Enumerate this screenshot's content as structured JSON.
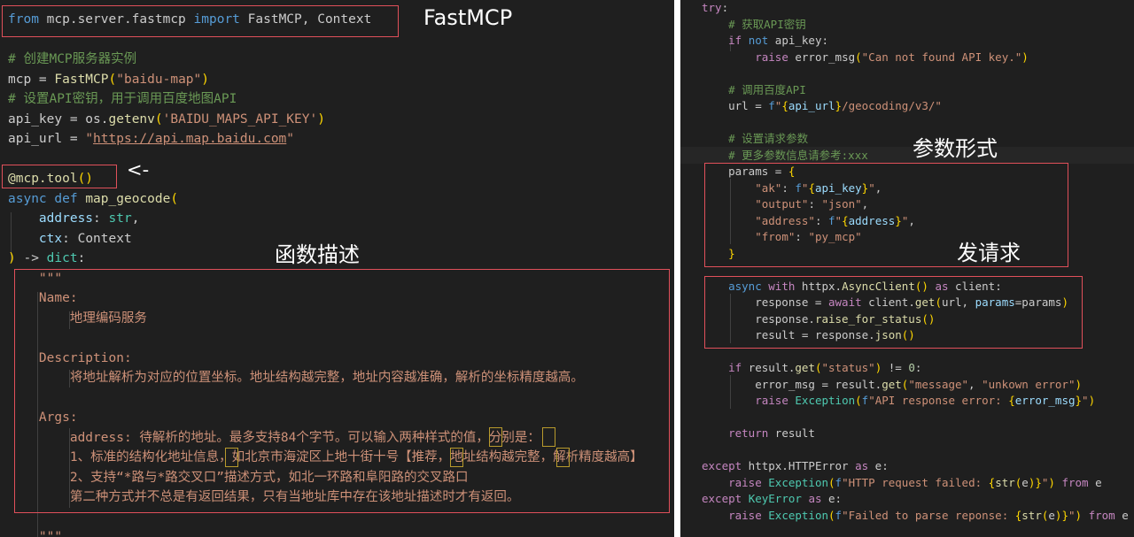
{
  "left_code": [
    [
      [
        "kw",
        "from"
      ],
      [
        "p",
        " mcp.server.fastmcp "
      ],
      [
        "kw",
        "import"
      ],
      [
        "p",
        " FastMCP, Context"
      ]
    ],
    [],
    [
      [
        "cm",
        "# 创建MCP服务器实例"
      ]
    ],
    [
      [
        "p",
        "mcp = "
      ],
      [
        "fn",
        "FastMCP"
      ],
      [
        "br",
        "("
      ],
      [
        "str",
        "\"baidu-map\""
      ],
      [
        "br",
        ")"
      ]
    ],
    [
      [
        "cm",
        "# 设置API密钥，用于调用百度地图API"
      ]
    ],
    [
      [
        "p",
        "api_key = os."
      ],
      [
        "fn",
        "getenv"
      ],
      [
        "br",
        "("
      ],
      [
        "str",
        "'BAIDU_MAPS_API_KEY'"
      ],
      [
        "br",
        ")"
      ]
    ],
    [
      [
        "p",
        "api_url = "
      ],
      [
        "str",
        "\""
      ],
      [
        "url",
        "https://api.map.baidu.com"
      ],
      [
        "str",
        "\""
      ]
    ],
    [],
    [
      [
        "fn",
        "@mcp.tool"
      ],
      [
        "br",
        "()"
      ]
    ],
    [
      [
        "kw",
        "async"
      ],
      [
        "p",
        " "
      ],
      [
        "kw",
        "def"
      ],
      [
        "p",
        " "
      ],
      [
        "fn",
        "map_geocode"
      ],
      [
        "br",
        "("
      ]
    ],
    [
      [
        "p",
        "    "
      ],
      [
        "var",
        "address"
      ],
      [
        "p",
        ": "
      ],
      [
        "cls",
        "str"
      ],
      [
        "p",
        ","
      ]
    ],
    [
      [
        "p",
        "    "
      ],
      [
        "var",
        "ctx"
      ],
      [
        "p",
        ": Context"
      ]
    ],
    [
      [
        "br",
        ")"
      ],
      [
        "p",
        " -> "
      ],
      [
        "cls",
        "dict"
      ],
      [
        "p",
        ":"
      ]
    ],
    [
      [
        "doc",
        "    \"\"\""
      ]
    ],
    [
      [
        "doc",
        "    Name:"
      ]
    ],
    [
      [
        "doc",
        "        地理编码服务"
      ]
    ],
    [],
    [
      [
        "doc",
        "    Description:"
      ]
    ],
    [
      [
        "doc",
        "        将地址解析为对应的位置坐标。地址结构越完整，地址内容越准确，解析的坐标精度越高。"
      ]
    ],
    [],
    [
      [
        "doc",
        "    Args:"
      ]
    ],
    [
      [
        "doc",
        "        address: 待解析的地址。最多支持84个字节。可以输入两种样式的值，分别是："
      ]
    ],
    [
      [
        "doc",
        "        1、标准的结构化地址信息，如北京市海淀区上地十街十号【推荐，地址结构越完整，解析精度越高】"
      ]
    ],
    [
      [
        "doc",
        "        2、支持“*路与*路交叉口”描述方式，如北一环路和阜阳路的交叉路口"
      ]
    ],
    [
      [
        "doc",
        "        第二种方式并不总是有返回结果，只有当地址库中存在该地址描述时才有返回。"
      ]
    ],
    [],
    [
      [
        "doc",
        "    \"\"\""
      ]
    ]
  ],
  "right_code": [
    [
      [
        "ctl",
        "try"
      ],
      [
        "p",
        ":"
      ]
    ],
    [
      [
        "cm",
        "    # 获取API密钥"
      ]
    ],
    [
      [
        "p",
        "    "
      ],
      [
        "ctl",
        "if"
      ],
      [
        "p",
        " "
      ],
      [
        "kw",
        "not"
      ],
      [
        "p",
        " api_key:"
      ]
    ],
    [
      [
        "p",
        "        "
      ],
      [
        "ctl",
        "raise"
      ],
      [
        "p",
        " error_msg"
      ],
      [
        "br",
        "("
      ],
      [
        "str",
        "\"Can not found API key.\""
      ],
      [
        "br",
        ")"
      ]
    ],
    [],
    [
      [
        "cm",
        "    # 调用百度API"
      ]
    ],
    [
      [
        "p",
        "    url = "
      ],
      [
        "kw",
        "f"
      ],
      [
        "str",
        "\""
      ],
      [
        "br",
        "{"
      ],
      [
        "var",
        "api_url"
      ],
      [
        "br",
        "}"
      ],
      [
        "str",
        "/geocoding/v3/\""
      ]
    ],
    [],
    [
      [
        "cm",
        "    # 设置请求参数"
      ]
    ],
    [
      [
        "cm",
        "    # 更多参数信息请参考:xxx"
      ]
    ],
    [
      [
        "p",
        "    params = "
      ],
      [
        "br",
        "{"
      ]
    ],
    [
      [
        "p",
        "        "
      ],
      [
        "str",
        "\"ak\""
      ],
      [
        "p",
        ": "
      ],
      [
        "kw",
        "f"
      ],
      [
        "str",
        "\""
      ],
      [
        "br",
        "{"
      ],
      [
        "var",
        "api_key"
      ],
      [
        "br",
        "}"
      ],
      [
        "str",
        "\""
      ],
      [
        "p",
        ","
      ]
    ],
    [
      [
        "p",
        "        "
      ],
      [
        "str",
        "\"output\""
      ],
      [
        "p",
        ": "
      ],
      [
        "str",
        "\"json\""
      ],
      [
        "p",
        ","
      ]
    ],
    [
      [
        "p",
        "        "
      ],
      [
        "str",
        "\"address\""
      ],
      [
        "p",
        ": "
      ],
      [
        "kw",
        "f"
      ],
      [
        "str",
        "\""
      ],
      [
        "br",
        "{"
      ],
      [
        "var",
        "address"
      ],
      [
        "br",
        "}"
      ],
      [
        "str",
        "\""
      ],
      [
        "p",
        ","
      ]
    ],
    [
      [
        "p",
        "        "
      ],
      [
        "str",
        "\"from\""
      ],
      [
        "p",
        ": "
      ],
      [
        "str",
        "\"py_mcp\""
      ]
    ],
    [
      [
        "p",
        "    "
      ],
      [
        "br",
        "}"
      ]
    ],
    [],
    [
      [
        "p",
        "    "
      ],
      [
        "kw",
        "async"
      ],
      [
        "p",
        " "
      ],
      [
        "ctl",
        "with"
      ],
      [
        "p",
        " httpx."
      ],
      [
        "fn",
        "AsyncClient"
      ],
      [
        "br",
        "()"
      ],
      [
        "p",
        " "
      ],
      [
        "ctl",
        "as"
      ],
      [
        "p",
        " client:"
      ]
    ],
    [
      [
        "p",
        "        response = "
      ],
      [
        "ctl",
        "await"
      ],
      [
        "p",
        " client."
      ],
      [
        "fn",
        "get"
      ],
      [
        "br",
        "("
      ],
      [
        "p",
        "url, "
      ],
      [
        "var",
        "params"
      ],
      [
        "p",
        "=params"
      ],
      [
        "br",
        ")"
      ]
    ],
    [
      [
        "p",
        "        response."
      ],
      [
        "fn",
        "raise_for_status"
      ],
      [
        "br",
        "()"
      ]
    ],
    [
      [
        "p",
        "        result = response."
      ],
      [
        "fn",
        "json"
      ],
      [
        "br",
        "()"
      ]
    ],
    [],
    [
      [
        "p",
        "    "
      ],
      [
        "ctl",
        "if"
      ],
      [
        "p",
        " result."
      ],
      [
        "fn",
        "get"
      ],
      [
        "br",
        "("
      ],
      [
        "str",
        "\"status\""
      ],
      [
        "br",
        ")"
      ],
      [
        "p",
        " != "
      ],
      [
        "num",
        "0"
      ],
      [
        "p",
        ":"
      ]
    ],
    [
      [
        "p",
        "        error_msg = result."
      ],
      [
        "fn",
        "get"
      ],
      [
        "br",
        "("
      ],
      [
        "str",
        "\"message\""
      ],
      [
        "p",
        ", "
      ],
      [
        "str",
        "\"unkown error\""
      ],
      [
        "br",
        ")"
      ]
    ],
    [
      [
        "p",
        "        "
      ],
      [
        "ctl",
        "raise"
      ],
      [
        "p",
        " "
      ],
      [
        "cls",
        "Exception"
      ],
      [
        "br",
        "("
      ],
      [
        "kw",
        "f"
      ],
      [
        "str",
        "\"API response error: "
      ],
      [
        "br",
        "{"
      ],
      [
        "var",
        "error_msg"
      ],
      [
        "br",
        "}"
      ],
      [
        "str",
        "\""
      ],
      [
        "br",
        ")"
      ]
    ],
    [],
    [
      [
        "p",
        "    "
      ],
      [
        "ctl",
        "return"
      ],
      [
        "p",
        " result"
      ]
    ],
    [],
    [
      [
        "ctl",
        "except"
      ],
      [
        "p",
        " httpx.HTTPError "
      ],
      [
        "ctl",
        "as"
      ],
      [
        "p",
        " e:"
      ]
    ],
    [
      [
        "p",
        "    "
      ],
      [
        "ctl",
        "raise"
      ],
      [
        "p",
        " "
      ],
      [
        "cls",
        "Exception"
      ],
      [
        "br",
        "("
      ],
      [
        "kw",
        "f"
      ],
      [
        "str",
        "\"HTTP request failed: "
      ],
      [
        "br",
        "{"
      ],
      [
        "fn",
        "str"
      ],
      [
        "br",
        "("
      ],
      [
        "p",
        "e"
      ],
      [
        "br",
        ")"
      ],
      [
        "br",
        "}"
      ],
      [
        "str",
        "\""
      ],
      [
        "br",
        ")"
      ],
      [
        "p",
        " "
      ],
      [
        "ctl",
        "from"
      ],
      [
        "p",
        " e"
      ]
    ],
    [
      [
        "ctl",
        "except"
      ],
      [
        "p",
        " "
      ],
      [
        "cls",
        "KeyError"
      ],
      [
        "p",
        " "
      ],
      [
        "ctl",
        "as"
      ],
      [
        "p",
        " e:"
      ]
    ],
    [
      [
        "p",
        "    "
      ],
      [
        "ctl",
        "raise"
      ],
      [
        "p",
        " "
      ],
      [
        "cls",
        "Exception"
      ],
      [
        "br",
        "("
      ],
      [
        "kw",
        "f"
      ],
      [
        "str",
        "\"Failed to parse reponse: "
      ],
      [
        "br",
        "{"
      ],
      [
        "fn",
        "str"
      ],
      [
        "br",
        "("
      ],
      [
        "p",
        "e"
      ],
      [
        "br",
        ")"
      ],
      [
        "br",
        "}"
      ],
      [
        "str",
        "\""
      ],
      [
        "br",
        ")"
      ],
      [
        "p",
        " "
      ],
      [
        "ctl",
        "from"
      ],
      [
        "p",
        " e"
      ]
    ]
  ],
  "annotations": {
    "fastmcp": "FastMCP",
    "arrow": "<-",
    "func_desc": "函数描述",
    "param_form": "参数形式",
    "send_request": "发请求"
  },
  "colors": {
    "background": "#1f1f1f",
    "annotation_box": "#e0505a",
    "keyword": "#569cd6",
    "control": "#c586c0",
    "string": "#ce9178",
    "function": "#dcdcaa",
    "class": "#4ec9b0",
    "variable": "#9cdcfe",
    "comment": "#6a9955"
  }
}
